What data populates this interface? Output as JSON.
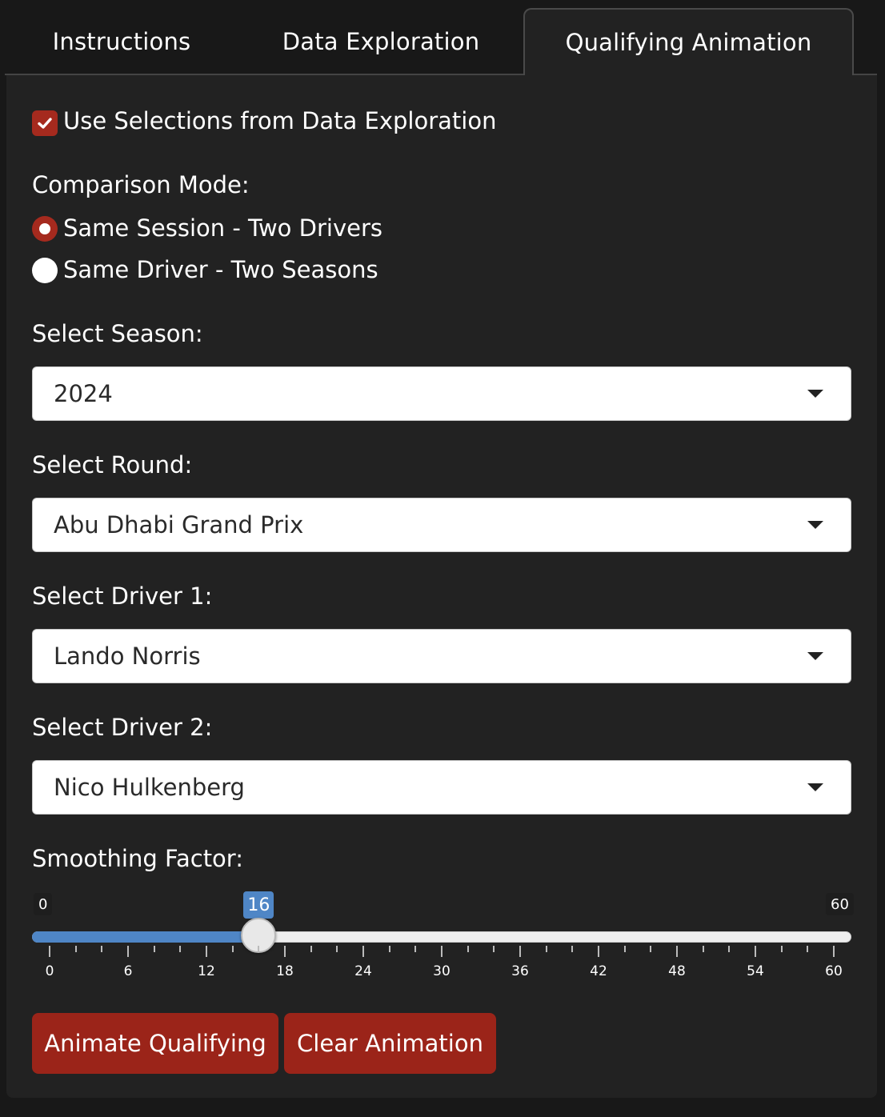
{
  "tabs": [
    {
      "label": "Instructions",
      "active": false
    },
    {
      "label": "Data Exploration",
      "active": false
    },
    {
      "label": "Qualifying Animation",
      "active": true
    }
  ],
  "use_selections": {
    "label": "Use Selections from Data Exploration",
    "checked": true
  },
  "comparison_mode": {
    "label": "Comparison Mode:",
    "options": [
      {
        "label": "Same Session - Two Drivers",
        "selected": true
      },
      {
        "label": "Same Driver - Two Seasons",
        "selected": false
      }
    ]
  },
  "season": {
    "label": "Select Season:",
    "value": "2024"
  },
  "round": {
    "label": "Select Round:",
    "value": "Abu Dhabi Grand Prix"
  },
  "driver1": {
    "label": "Select Driver 1:",
    "value": "Lando Norris"
  },
  "driver2": {
    "label": "Select Driver 2:",
    "value": "Nico Hulkenberg"
  },
  "smoothing": {
    "label": "Smoothing Factor:",
    "min": 0,
    "max": 60,
    "value": 16,
    "min_label": "0",
    "max_label": "60",
    "value_label": "16",
    "tick_labels": [
      "0",
      "6",
      "12",
      "18",
      "24",
      "30",
      "36",
      "42",
      "48",
      "54",
      "60"
    ]
  },
  "buttons": {
    "animate": "Animate Qualifying",
    "clear": "Clear Animation"
  },
  "colors": {
    "accent_red": "#a52a1e",
    "slider_blue": "#4f86c6",
    "panel_bg": "#222222"
  }
}
